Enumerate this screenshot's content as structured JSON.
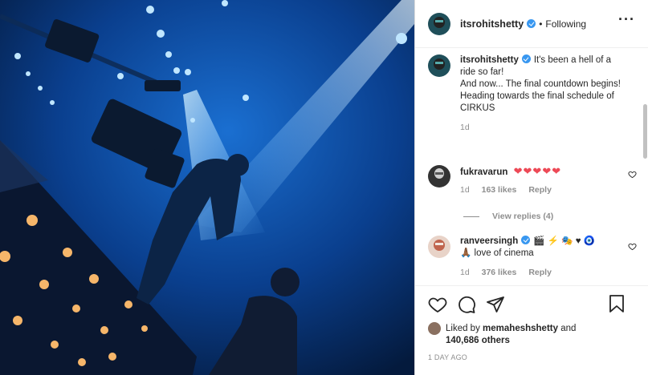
{
  "post": {
    "username": "itsrohitshetty",
    "separator": "•",
    "follow_status": "Following",
    "more_icon": "more-horizontal-icon"
  },
  "caption": {
    "username": "itsrohitshetty",
    "text_1": "It's been a hell of a ride so far!",
    "text_2": "And now... The final countdown begins!",
    "text_3": "Heading towards the final schedule of CIRKUS",
    "age": "1d"
  },
  "comments": [
    {
      "username": "fukravarun",
      "text": "❤❤❤❤❤",
      "age": "1d",
      "likes": "163 likes",
      "reply": "Reply"
    },
    {
      "username": "ranveersingh",
      "text_1": "🎬 ⚡ 🎭 ♥ 🧿",
      "text_2": "🙏🏾 love of cinema",
      "age": "1d",
      "likes": "376 likes",
      "reply": "Reply"
    }
  ],
  "view_replies": "View replies (4)",
  "likes": {
    "prefix": "Liked by",
    "user": "memaheshshetty",
    "and": "and",
    "count": "140,686 others"
  },
  "timestamp": "1 DAY AGO",
  "colors": {
    "verified": "#3897f0",
    "heart_red": "#ed4956",
    "muted": "#8e8e8e"
  }
}
